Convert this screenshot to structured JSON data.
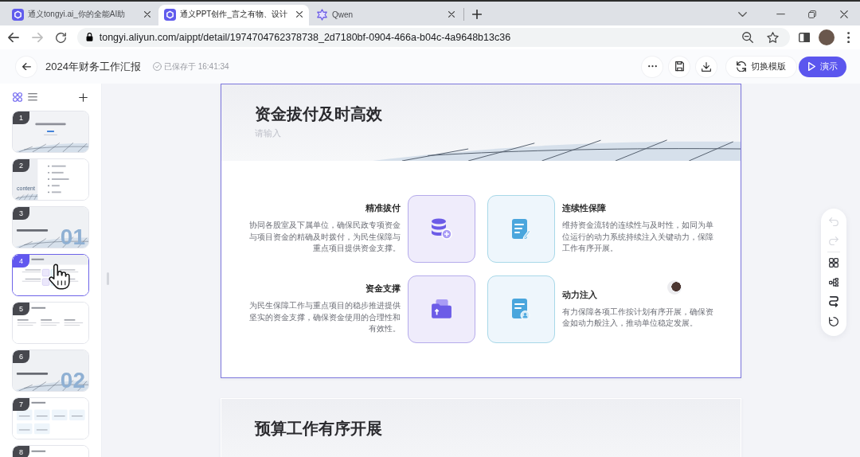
{
  "browser": {
    "tabs": [
      {
        "title": "通义tongyi.ai_你的全能AI助",
        "kind": "tile",
        "selected": false
      },
      {
        "title": "通义PPT创作_言之有物、设计",
        "kind": "tile",
        "selected": true
      },
      {
        "title": "Qwen",
        "kind": "star",
        "selected": false
      }
    ],
    "nav_buttons": [
      {
        "kind": "back",
        "disabled": false
      },
      {
        "kind": "forward",
        "disabled": true
      },
      {
        "kind": "reload",
        "disabled": false
      }
    ],
    "url": "tongyi.aliyun.com/aippt/detail/1974704762378738_2d7180bf-0904-466a-b04c-4a9648b13c36"
  },
  "header": {
    "title": "2024年财务工作汇报",
    "saved_status": "已保存于 16:41:34",
    "buttons": [
      {
        "kind": "template",
        "label": "切换模版"
      },
      {
        "kind": "present",
        "label": "演示"
      }
    ]
  },
  "slide_rail": {
    "view_modes": [
      {
        "kind": "grid",
        "selected": true
      },
      {
        "kind": "list",
        "selected": false
      }
    ],
    "thumbnails": [
      {
        "number": "1",
        "kind": "cover",
        "selected": false
      },
      {
        "number": "2",
        "kind": "agenda",
        "label": "content",
        "selected": false
      },
      {
        "number": "3",
        "kind": "section",
        "label": "01",
        "selected": false
      },
      {
        "number": "4",
        "kind": "grid",
        "selected": true
      },
      {
        "number": "5",
        "kind": "columns",
        "selected": false
      },
      {
        "number": "6",
        "kind": "section",
        "label": "02",
        "selected": false
      },
      {
        "number": "7",
        "kind": "cards",
        "selected": false
      },
      {
        "number": "8",
        "kind": "columns",
        "selected": false
      }
    ]
  },
  "slides": [
    {
      "title": "资金拔付及时高效",
      "placeholder": "请输入",
      "selected": true,
      "features": [
        {
          "title": "精准拔付",
          "text": "协同各股室及下属单位，确保民政专项资金与项目资金的精确及时拨付，为民生保障与重点项目提供资金支撑。",
          "kind": "database"
        },
        {
          "title": "连续性保障",
          "text": "维持资金流转的连续性与及时性，如同为单位运行的动力系统持续注入关键动力，保障工作有序开展。",
          "kind": "note"
        },
        {
          "title": "资金支撑",
          "text": "为民生保障工作与重点项目的稳步推进提供坚实的资金支撑，确保资金使用的合理性和有效性。",
          "kind": "folder"
        },
        {
          "title": "动力注入",
          "text": "有力保障各项工作按计划有序开展，确保资金如动力般注入，推动单位稳定发展。",
          "kind": "profile"
        }
      ]
    },
    {
      "title": "预算工作有序开展",
      "selected": false
    }
  ],
  "side_tools": [
    {
      "kind": "undo",
      "disabled": true
    },
    {
      "kind": "redo",
      "disabled": true
    },
    {
      "kind": "grid",
      "disabled": false
    },
    {
      "kind": "hierarchy",
      "disabled": false
    },
    {
      "kind": "swap",
      "disabled": false
    },
    {
      "kind": "loop",
      "disabled": false
    }
  ]
}
